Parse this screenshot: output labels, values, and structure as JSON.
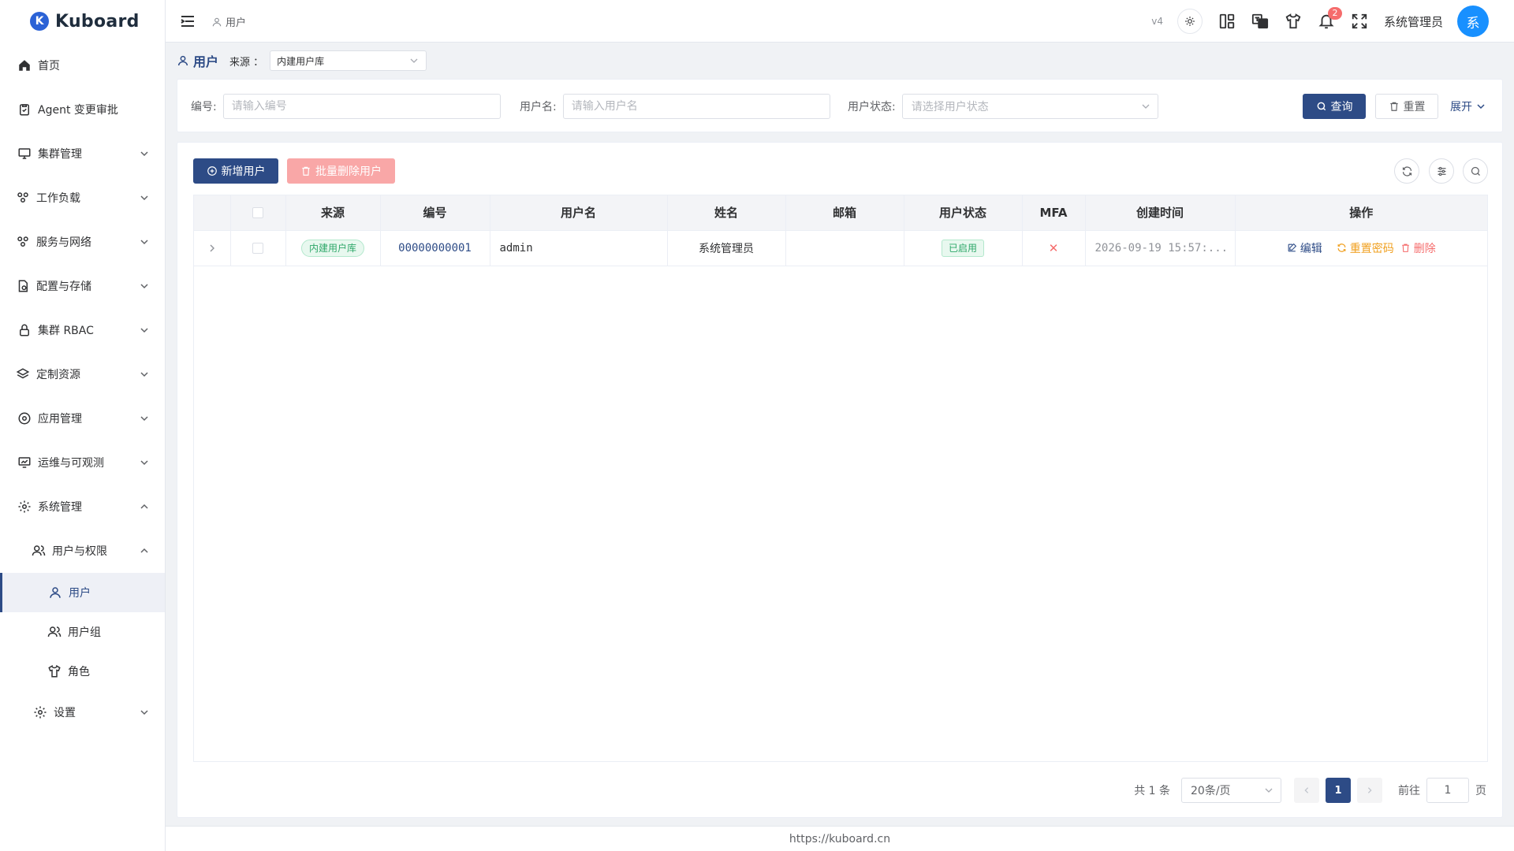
{
  "app": {
    "logo_letter": "K",
    "name": "Kuboard"
  },
  "sidebar": {
    "items": [
      {
        "label": "首页"
      },
      {
        "label": "Agent 变更审批"
      },
      {
        "label": "集群管理"
      },
      {
        "label": "工作负载"
      },
      {
        "label": "服务与网络"
      },
      {
        "label": "配置与存储"
      },
      {
        "label": "集群 RBAC"
      },
      {
        "label": "定制资源"
      },
      {
        "label": "应用管理"
      },
      {
        "label": "运维与可观测"
      },
      {
        "label": "系统管理"
      },
      {
        "label": "用户与权限"
      },
      {
        "label": "用户"
      },
      {
        "label": "用户组"
      },
      {
        "label": "角色"
      },
      {
        "label": "设置"
      }
    ]
  },
  "header": {
    "breadcrumb": "用户",
    "version": "v4",
    "notification_count": "2",
    "user_name": "系统管理员",
    "avatar_text": "系"
  },
  "page": {
    "title": "用户",
    "source_label": "来源 ：",
    "source_value": "内建用户库"
  },
  "search": {
    "code_label": "编号:",
    "code_placeholder": "请输入编号",
    "username_label": "用户名:",
    "username_placeholder": "请输入用户名",
    "status_label": "用户状态:",
    "status_placeholder": "请选择用户状态",
    "query_button": "查询",
    "reset_button": "重置",
    "expand_link": "展开"
  },
  "toolbar": {
    "add_button": "新增用户",
    "batch_delete_button": "批量删除用户"
  },
  "table": {
    "columns": [
      "来源",
      "编号",
      "用户名",
      "姓名",
      "邮箱",
      "用户状态",
      "MFA",
      "创建时间",
      "操作"
    ],
    "rows": [
      {
        "source": "内建用户库",
        "code": "00000000001",
        "username": "admin",
        "name": "系统管理员",
        "email": "",
        "status": "已启用",
        "mfa": "✕",
        "created": "2026-09-19 15:57:...",
        "op_edit": "编辑",
        "op_reset": "重置密码",
        "op_delete": "删除"
      }
    ]
  },
  "pagination": {
    "total_text": "共 1 条",
    "page_size": "20条/页",
    "current_page": "1",
    "goto_label": "前往",
    "goto_value": "1",
    "page_suffix": "页"
  },
  "footer": {
    "text": "https://kuboard.cn"
  },
  "colors": {
    "primary": "#2d4b86",
    "danger": "#f56c6c",
    "warning": "#f0a020",
    "success": "#2fa86a",
    "avatar": "#1890ff"
  }
}
